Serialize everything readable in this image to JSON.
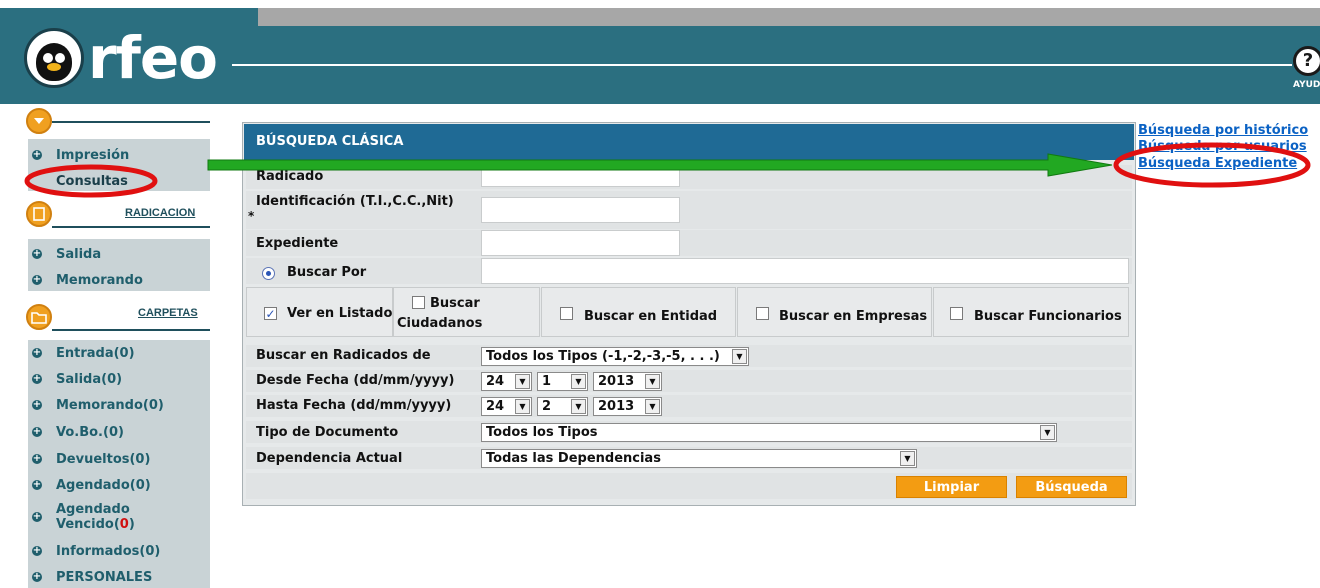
{
  "header": {
    "logo_text": "rfeo",
    "help_glyph": "?",
    "help_label": "AYUD"
  },
  "sidebar": {
    "top_items": [
      {
        "label": "Impresión"
      },
      {
        "label": "Consultas"
      }
    ],
    "radicacion": {
      "title": "RADICACION",
      "items": [
        {
          "label": "Salida"
        },
        {
          "label": "Memorando"
        }
      ]
    },
    "carpetas": {
      "title": "CARPETAS",
      "items": [
        {
          "label": "Entrada(0)"
        },
        {
          "label": "Salida(0)"
        },
        {
          "label": "Memorando(0)"
        },
        {
          "label": "Vo.Bo.(0)"
        },
        {
          "label": "Devueltos(0)"
        },
        {
          "label": "Agendado(0)"
        },
        {
          "label_a": "Agendado",
          "label_b": "Vencido(",
          "label_count": "0",
          "label_end": ")"
        },
        {
          "label": "Informados(0)"
        },
        {
          "label": "PERSONALES"
        }
      ]
    }
  },
  "form": {
    "title": "BÚSQUEDA CLÁSICA",
    "radicado_label": "Radicado",
    "identificacion_label": "Identificación (T.I.,C.C.,Nit)",
    "required_mark": "*",
    "expediente_label": "Expediente",
    "buscar_por_label": "Buscar Por",
    "checks": {
      "ver_listado": "Ver en Listado",
      "buscar_ciudadanos_a": "Buscar",
      "buscar_ciudadanos_b": "Ciudadanos",
      "buscar_entidad": "Buscar en Entidad",
      "buscar_empresas": "Buscar en Empresas",
      "buscar_funcionarios": "Buscar Funcionarios"
    },
    "buscar_radicados_label": "Buscar en Radicados de",
    "tipos_value": "Todos los Tipos (-1,-2,-3,-5, . . .)",
    "desde_label": "Desde Fecha (dd/mm/yyyy)",
    "desde": {
      "day": "24",
      "month": "1",
      "year": "2013"
    },
    "hasta_label": "Hasta Fecha (dd/mm/yyyy)",
    "hasta": {
      "day": "24",
      "month": "2",
      "year": "2013"
    },
    "tipo_doc_label": "Tipo de Documento",
    "tipo_doc_value": "Todos los Tipos",
    "dependencia_label": "Dependencia Actual",
    "dependencia_value": "Todas las Dependencias",
    "limpiar": "Limpiar",
    "busqueda": "Búsqueda"
  },
  "links": {
    "historico": "Búsqueda por histórico",
    "usuarios": "Búsqueda por usuarios",
    "expediente": "Búsqueda Expediente"
  },
  "colors": {
    "header": "#2b6f80",
    "accent_orange": "#f39c12",
    "title_blue": "#1f6a95",
    "annotation_red": "#e01010",
    "annotation_green": "#22a822"
  }
}
